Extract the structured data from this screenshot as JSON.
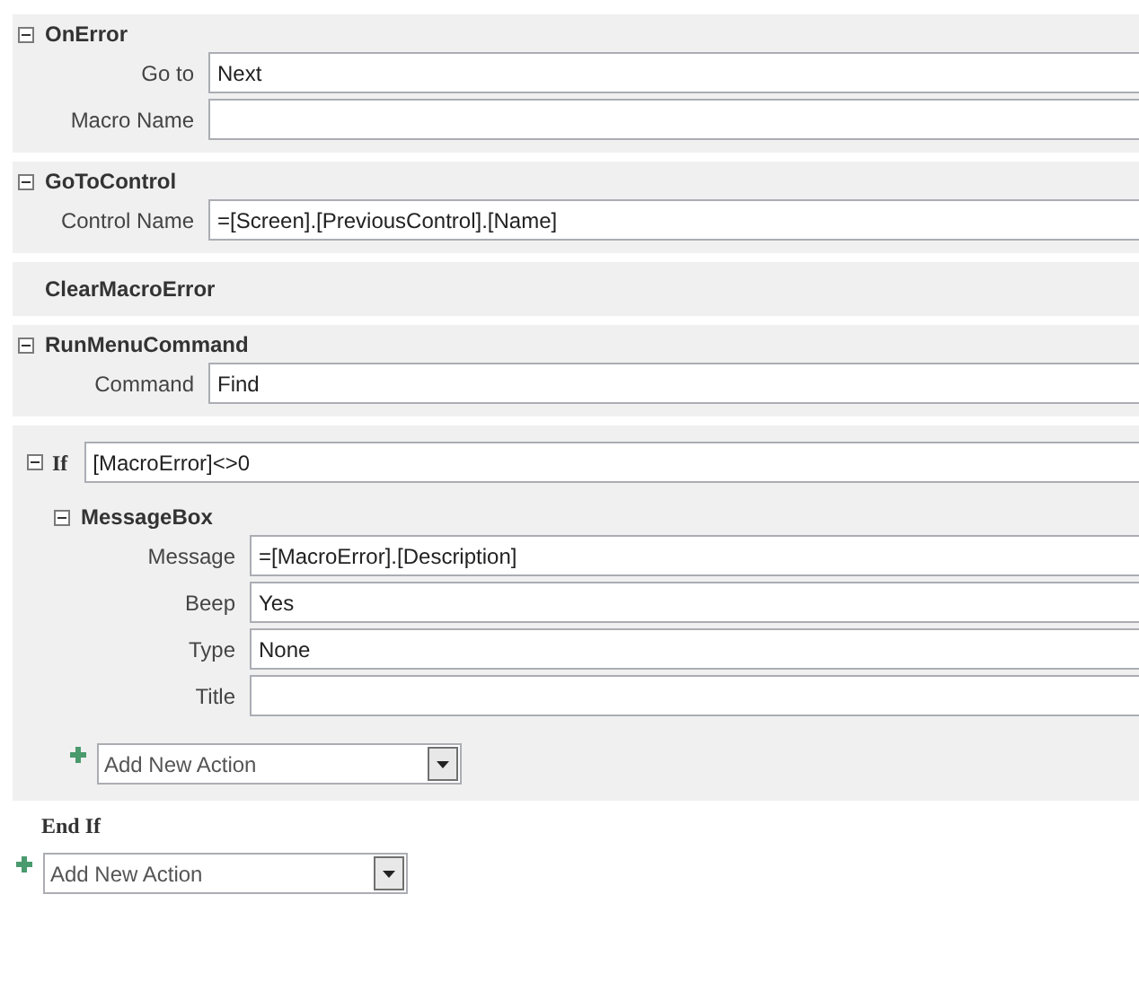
{
  "actions": [
    {
      "kind": "action",
      "name": "OnError",
      "expanded": true,
      "arguments": [
        {
          "label": "Go to",
          "value": "Next"
        },
        {
          "label": "Macro Name"
        }
      ]
    },
    {
      "kind": "action",
      "name": "GoToControl",
      "expanded": true,
      "arguments": [
        {
          "label": "Control Name",
          "value": "=[Screen].[PreviousControl].[Name]"
        }
      ]
    },
    {
      "kind": "simple",
      "name": "ClearMacroError"
    },
    {
      "kind": "action",
      "name": "RunMenuCommand",
      "expanded": true,
      "arguments": [
        {
          "label": "Command",
          "value": "Find"
        }
      ]
    },
    {
      "kind": "if",
      "keyword": "If",
      "condition": "[MacroError]<>0",
      "expanded": true,
      "children": [
        {
          "kind": "action",
          "name": "MessageBox",
          "expanded": true,
          "arguments": [
            {
              "label": "Message",
              "value": "=[MacroError].[Description]"
            },
            {
              "label": "Beep",
              "value": "Yes"
            },
            {
              "label": "Type",
              "value": "None"
            },
            {
              "label": "Title"
            }
          ]
        }
      ],
      "add_action": {
        "placeholder": "Add New Action"
      },
      "end_label": "End If"
    }
  ],
  "add_action": {
    "placeholder": "Add New Action"
  }
}
